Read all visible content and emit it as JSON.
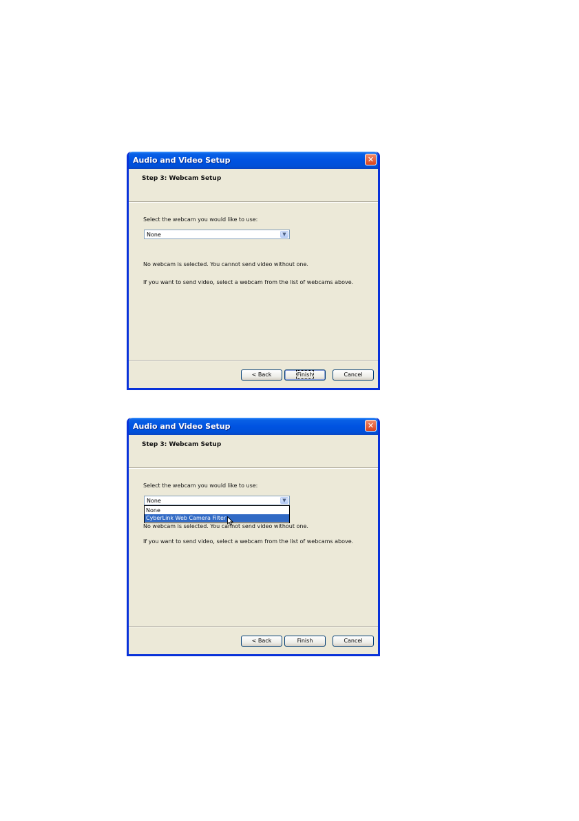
{
  "dialogs": [
    {
      "title": "Audio and Video Setup",
      "step_title": "Step 3: Webcam Setup",
      "prompt": "Select the webcam you would like to use:",
      "selected_webcam": "None",
      "status_text": "No webcam is selected. You cannot send video without one.",
      "hint_text": "If you want to send video, select a webcam from the list of webcams above.",
      "buttons": {
        "back": "< Back",
        "finish": "Finish",
        "cancel": "Cancel"
      }
    },
    {
      "title": "Audio and Video Setup",
      "step_title": "Step 3: Webcam Setup",
      "prompt": "Select the webcam you would like to use:",
      "selected_webcam": "None",
      "dropdown_options": [
        "None",
        "CyberLink Web Camera Filter"
      ],
      "highlighted_option": "CyberLink Web Camera Filter",
      "status_text": "No webcam is selected. You cannot send video without one.",
      "hint_text": "If you want to send video, select a webcam from the list of webcams above.",
      "buttons": {
        "back": "< Back",
        "finish": "Finish",
        "cancel": "Cancel"
      }
    }
  ],
  "colors": {
    "titlebar": "#0053e1",
    "dialog_bg": "#ece9d8",
    "highlight": "#316ac5",
    "close": "#d9441f"
  },
  "icons": {
    "close": "close-icon",
    "dropdown": "chevron-down-icon",
    "cursor": "mouse-pointer-icon"
  }
}
